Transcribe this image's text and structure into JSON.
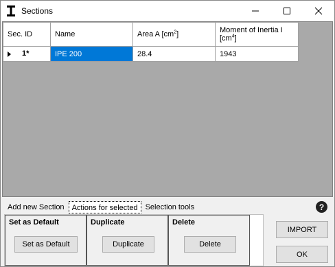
{
  "window": {
    "title": "Sections"
  },
  "grid": {
    "columns": [
      {
        "label": "Sec. ID"
      },
      {
        "label": "Name"
      },
      {
        "label": "Area A [cm",
        "sup": "2",
        "suffix": "]"
      },
      {
        "label": "Moment of Inertia I",
        "label2": "[cm",
        "sup": "4",
        "suffix": "]"
      }
    ],
    "rows": [
      {
        "id": "1*",
        "name": "IPE 200",
        "area": "28.4",
        "moi": "1943"
      }
    ]
  },
  "tabs": [
    {
      "label": "Add new Section"
    },
    {
      "label": "Actions for selected"
    },
    {
      "label": "Selection tools"
    }
  ],
  "groups": {
    "default": {
      "title": "Set as Default",
      "button": "Set as Default"
    },
    "duplicate": {
      "title": "Duplicate",
      "button": "Duplicate"
    },
    "delete": {
      "title": "Delete",
      "button": "Delete"
    }
  },
  "buttons": {
    "import": "IMPORT",
    "ok": "OK"
  },
  "help": {
    "glyph": "?"
  }
}
